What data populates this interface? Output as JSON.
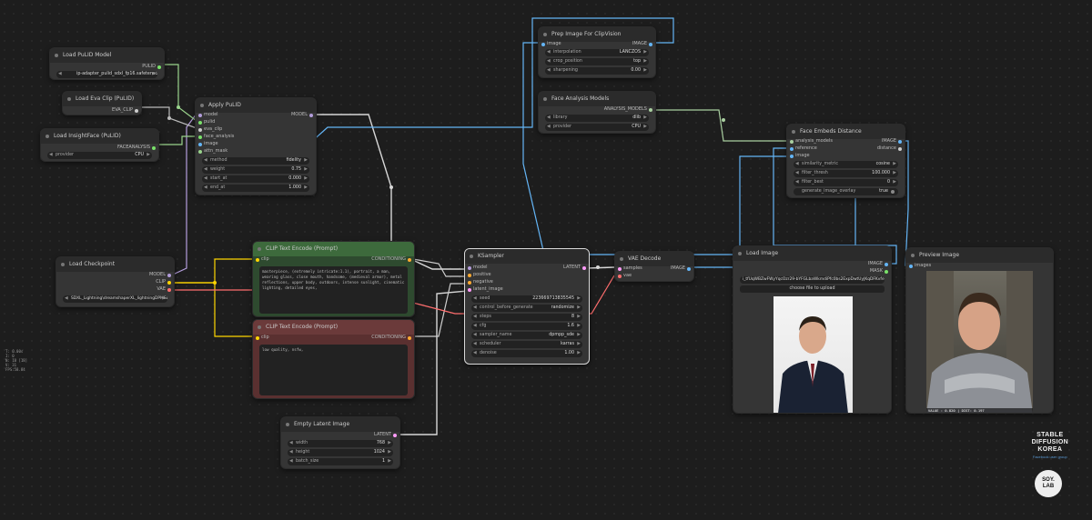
{
  "nodes": {
    "pulid_model": {
      "title": "Load PuLID Model",
      "output": "PULID",
      "widget": {
        "label": "pulid_file",
        "value": "ip-adapter_pulid_sdxl_fp16.safetensors"
      }
    },
    "eva_clip": {
      "title": "Load Eva Clip (PuLID)",
      "output": "EVA_CLIP"
    },
    "insightface": {
      "title": "Load InsightFace (PuLID)",
      "output": "FACEANALYSIS",
      "widget": {
        "label": "provider",
        "value": "CPU"
      }
    },
    "apply_pulid": {
      "title": "Apply PuLID",
      "inputs": [
        "model",
        "pulid",
        "eva_clip",
        "face_analysis",
        "image",
        "attn_mask"
      ],
      "output": "MODEL",
      "widgets": [
        {
          "label": "method",
          "value": "fidelity"
        },
        {
          "label": "weight",
          "value": "0.75"
        },
        {
          "label": "start_at",
          "value": "0.000"
        },
        {
          "label": "end_at",
          "value": "1.000"
        }
      ]
    },
    "checkpoint": {
      "title": "Load Checkpoint",
      "outputs": [
        "MODEL",
        "CLIP",
        "VAE"
      ],
      "widget": {
        "label": "ckpt_name",
        "value": "SDXL_Lightning\\dreamshaperXL_lightningDPMSDE.safetensors"
      }
    },
    "clip_pos": {
      "title": "CLIP Text Encode (Prompt)",
      "input": "clip",
      "output": "CONDITIONING",
      "text": "masterpiece, (extremely intricate:1.1), portrait, a man, wearing glass, close mouth, handsome, (medieval armor), metal reflections, upper body, outdoors, intense sunlight, cinematic lighting, detailed eyes,"
    },
    "clip_neg": {
      "title": "CLIP Text Encode (Prompt)",
      "input": "clip",
      "output": "CONDITIONING",
      "text": "low quality, nsfw,"
    },
    "empty_latent": {
      "title": "Empty Latent Image",
      "output": "LATENT",
      "widgets": [
        {
          "label": "width",
          "value": "768"
        },
        {
          "label": "height",
          "value": "1024"
        },
        {
          "label": "batch_size",
          "value": "1"
        }
      ]
    },
    "ksampler": {
      "title": "KSampler",
      "inputs": [
        "model",
        "positive",
        "negative",
        "latent_image"
      ],
      "output": "LATENT",
      "widgets": [
        {
          "label": "seed",
          "value": "223669713835545"
        },
        {
          "label": "control_before_generate",
          "value": "randomize"
        },
        {
          "label": "steps",
          "value": "8"
        },
        {
          "label": "cfg",
          "value": "1.6"
        },
        {
          "label": "sampler_name",
          "value": "dpmpp_sde"
        },
        {
          "label": "scheduler",
          "value": "karras"
        },
        {
          "label": "denoise",
          "value": "1.00"
        }
      ]
    },
    "vae_decode": {
      "title": "VAE Decode",
      "inputs": [
        "samples",
        "vae"
      ],
      "output": "IMAGE"
    },
    "prep_image": {
      "title": "Prep Image For ClipVision",
      "input": "image",
      "output": "IMAGE",
      "widgets": [
        {
          "label": "interpolation",
          "value": "LANCZOS"
        },
        {
          "label": "crop_position",
          "value": "top"
        },
        {
          "label": "sharpening",
          "value": "0.00"
        }
      ]
    },
    "face_models": {
      "title": "Face Analysis Models",
      "output": "ANALYSIS_MODELS",
      "widgets": [
        {
          "label": "library",
          "value": "dlib"
        },
        {
          "label": "provider",
          "value": "CPU"
        }
      ]
    },
    "face_dist": {
      "title": "Face Embeds Distance",
      "inputs": [
        "analysis_models",
        "reference",
        "image"
      ],
      "outputs": [
        "IMAGE",
        "distance"
      ],
      "widgets": [
        {
          "label": "similarity_metric",
          "value": "cosine"
        },
        {
          "label": "filter_thresh",
          "value": "100.000"
        },
        {
          "label": "filter_best",
          "value": "0"
        },
        {
          "label": "generate_image_overlay",
          "value": "true"
        }
      ]
    },
    "load_image": {
      "title": "Load Image",
      "outputs": [
        "IMAGE",
        "MASK"
      ],
      "filename": "i_tfUqWBZwFWyYqcOzr29-bYFGLbaWkmdiPfc0bs2ExpDwtUyJKqDFKvfeU7_QRVy61PBbi8zSiR7SAO_abEPMQ.webp",
      "upload_label": "choose file to upload"
    },
    "preview": {
      "title": "Preview Image",
      "input": "images",
      "overlay_text": "VALUE : 0.820 | DIST: 0.197"
    }
  },
  "stats": [
    "T: 0.00s",
    "I: 0",
    "N: 18 [18]",
    "V: 31",
    "FPS:58.84"
  ],
  "brand": {
    "line1": "STABLE",
    "line2": "DIFFUSION",
    "line3": "KOREA",
    "sub": "Facebook user group",
    "logo": "SOY.\nLAB"
  },
  "colors": {
    "model": "#b39ddb",
    "clip": "#ffd500",
    "vae": "#ff6e6e",
    "conditioning": "#ffa931",
    "latent": "#ff9cf9",
    "image": "#64b5f6",
    "pulid": "#7ae26a",
    "default": "#cccccc"
  }
}
